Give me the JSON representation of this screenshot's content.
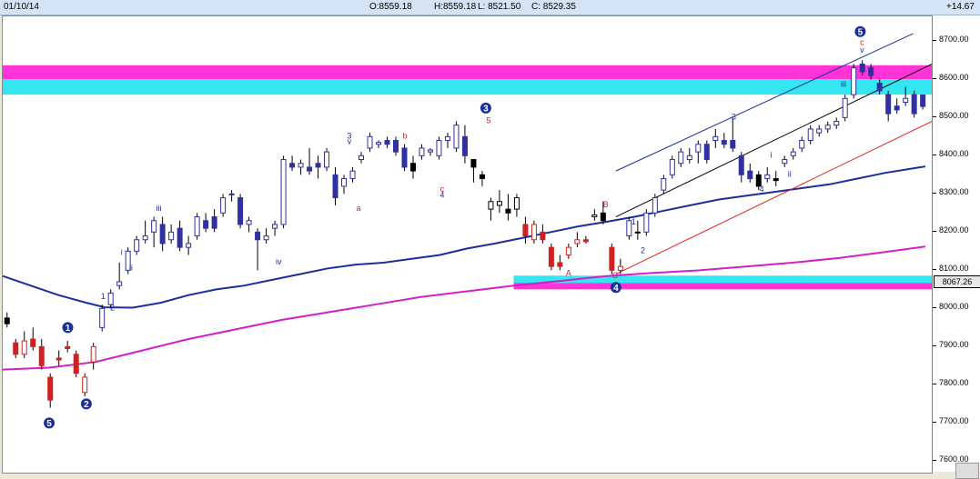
{
  "header": {
    "date": "01/10/14",
    "open": "O:8559.18",
    "high": "H:8559.18",
    "low": "L: 8521.50",
    "close": "C: 8529.35",
    "change": "+14.67"
  },
  "axis": {
    "labels": [
      "8700.00",
      "8600.00",
      "8500.00",
      "8400.00",
      "8300.00",
      "8200.00",
      "8100.00",
      "8000.00",
      "7900.00",
      "7800.00",
      "7700.00",
      "7600.00"
    ],
    "price_box": "8067.26"
  },
  "colors": {
    "up": "#3030a0",
    "down": "#000000",
    "up_red": "#d02020",
    "ma_short": "#1a2f9a",
    "ma_long": "#d020c8",
    "zone_cyan": "#33e6f0",
    "zone_magenta": "#ff33d6",
    "trend_red": "#e02020"
  },
  "chart_data": {
    "type": "candlestick",
    "ylim": [
      7570,
      8765
    ],
    "y_ticks": [
      8700,
      8600,
      8500,
      8400,
      8300,
      8200,
      8100,
      8000,
      7900,
      7800,
      7700,
      7600
    ],
    "zones": [
      {
        "color": "magenta",
        "top": 8637,
        "bottom": 8600,
        "x_from": 0,
        "x_to": 1
      },
      {
        "color": "cyan",
        "top": 8600,
        "bottom": 8560,
        "x_from": 0,
        "x_to": 1
      },
      {
        "color": "cyan",
        "top": 8086,
        "bottom": 8067,
        "x_from": 0.55,
        "x_to": 1
      },
      {
        "color": "magenta",
        "top": 8067,
        "bottom": 8050,
        "x_from": 0.55,
        "x_to": 1
      }
    ],
    "candles": [
      {
        "o": 7975,
        "h": 7990,
        "l": 7950,
        "c": 7960,
        "col": "down"
      },
      {
        "o": 7910,
        "h": 7920,
        "l": 7870,
        "c": 7880,
        "col": "down_red"
      },
      {
        "o": 7880,
        "h": 7940,
        "l": 7870,
        "c": 7915,
        "col": "up_red"
      },
      {
        "o": 7920,
        "h": 7950,
        "l": 7890,
        "c": 7900,
        "col": "down_red"
      },
      {
        "o": 7900,
        "h": 7920,
        "l": 7840,
        "c": 7850,
        "col": "down_red"
      },
      {
        "o": 7820,
        "h": 7830,
        "l": 7740,
        "c": 7760,
        "col": "down_red"
      },
      {
        "o": 7870,
        "h": 7890,
        "l": 7850,
        "c": 7865,
        "col": "up_red"
      },
      {
        "o": 7900,
        "h": 7915,
        "l": 7885,
        "c": 7895,
        "col": "down_red"
      },
      {
        "o": 7880,
        "h": 7890,
        "l": 7820,
        "c": 7830,
        "col": "down_red"
      },
      {
        "o": 7780,
        "h": 7830,
        "l": 7770,
        "c": 7820,
        "col": "up_red"
      },
      {
        "o": 7860,
        "h": 7910,
        "l": 7840,
        "c": 7900,
        "col": "up_red"
      },
      {
        "o": 7950,
        "h": 8010,
        "l": 7940,
        "c": 8000,
        "col": "up"
      },
      {
        "o": 8010,
        "h": 8050,
        "l": 8000,
        "c": 8040,
        "col": "up"
      },
      {
        "o": 8060,
        "h": 8120,
        "l": 8050,
        "c": 8070,
        "col": "up"
      },
      {
        "o": 8100,
        "h": 8160,
        "l": 8090,
        "c": 8150,
        "col": "up"
      },
      {
        "o": 8150,
        "h": 8190,
        "l": 8140,
        "c": 8180,
        "col": "up"
      },
      {
        "o": 8180,
        "h": 8230,
        "l": 8170,
        "c": 8190,
        "col": "up"
      },
      {
        "o": 8200,
        "h": 8240,
        "l": 8160,
        "c": 8230,
        "col": "up"
      },
      {
        "o": 8220,
        "h": 8240,
        "l": 8150,
        "c": 8170,
        "col": "up"
      },
      {
        "o": 8180,
        "h": 8220,
        "l": 8170,
        "c": 8200,
        "col": "up"
      },
      {
        "o": 8210,
        "h": 8230,
        "l": 8150,
        "c": 8160,
        "col": "up"
      },
      {
        "o": 8160,
        "h": 8190,
        "l": 8140,
        "c": 8170,
        "col": "up"
      },
      {
        "o": 8190,
        "h": 8250,
        "l": 8180,
        "c": 8240,
        "col": "up"
      },
      {
        "o": 8230,
        "h": 8250,
        "l": 8200,
        "c": 8210,
        "col": "up"
      },
      {
        "o": 8240,
        "h": 8260,
        "l": 8200,
        "c": 8210,
        "col": "up"
      },
      {
        "o": 8250,
        "h": 8300,
        "l": 8240,
        "c": 8290,
        "col": "up"
      },
      {
        "o": 8300,
        "h": 8310,
        "l": 8280,
        "c": 8300,
        "col": "up"
      },
      {
        "o": 8290,
        "h": 8300,
        "l": 8210,
        "c": 8220,
        "col": "up"
      },
      {
        "o": 8220,
        "h": 8240,
        "l": 8200,
        "c": 8230,
        "col": "up"
      },
      {
        "o": 8200,
        "h": 8210,
        "l": 8100,
        "c": 8180,
        "col": "up"
      },
      {
        "o": 8180,
        "h": 8210,
        "l": 8170,
        "c": 8190,
        "col": "up"
      },
      {
        "o": 8210,
        "h": 8230,
        "l": 8190,
        "c": 8220,
        "col": "up"
      },
      {
        "o": 8220,
        "h": 8400,
        "l": 8210,
        "c": 8390,
        "col": "up"
      },
      {
        "o": 8380,
        "h": 8400,
        "l": 8360,
        "c": 8370,
        "col": "up"
      },
      {
        "o": 8370,
        "h": 8390,
        "l": 8350,
        "c": 8380,
        "col": "up"
      },
      {
        "o": 8370,
        "h": 8420,
        "l": 8350,
        "c": 8360,
        "col": "up"
      },
      {
        "o": 8380,
        "h": 8400,
        "l": 8340,
        "c": 8370,
        "col": "up"
      },
      {
        "o": 8370,
        "h": 8420,
        "l": 8360,
        "c": 8410,
        "col": "up"
      },
      {
        "o": 8350,
        "h": 8370,
        "l": 8270,
        "c": 8290,
        "col": "up"
      },
      {
        "o": 8320,
        "h": 8350,
        "l": 8300,
        "c": 8340,
        "col": "up"
      },
      {
        "o": 8340,
        "h": 8370,
        "l": 8330,
        "c": 8360,
        "col": "up"
      },
      {
        "o": 8390,
        "h": 8410,
        "l": 8380,
        "c": 8400,
        "col": "up"
      },
      {
        "o": 8420,
        "h": 8460,
        "l": 8410,
        "c": 8450,
        "col": "up"
      },
      {
        "o": 8430,
        "h": 8440,
        "l": 8420,
        "c": 8435,
        "col": "up"
      },
      {
        "o": 8440,
        "h": 8450,
        "l": 8420,
        "c": 8430,
        "col": "up"
      },
      {
        "o": 8440,
        "h": 8450,
        "l": 8400,
        "c": 8410,
        "col": "up"
      },
      {
        "o": 8420,
        "h": 8430,
        "l": 8360,
        "c": 8370,
        "col": "up"
      },
      {
        "o": 8380,
        "h": 8400,
        "l": 8340,
        "c": 8360,
        "col": "down"
      },
      {
        "o": 8400,
        "h": 8430,
        "l": 8390,
        "c": 8420,
        "col": "up"
      },
      {
        "o": 8410,
        "h": 8420,
        "l": 8400,
        "c": 8415,
        "col": "up"
      },
      {
        "o": 8400,
        "h": 8450,
        "l": 8390,
        "c": 8440,
        "col": "up"
      },
      {
        "o": 8440,
        "h": 8460,
        "l": 8420,
        "c": 8450,
        "col": "up"
      },
      {
        "o": 8420,
        "h": 8490,
        "l": 8410,
        "c": 8480,
        "col": "up"
      },
      {
        "o": 8450,
        "h": 8480,
        "l": 8380,
        "c": 8400,
        "col": "up"
      },
      {
        "o": 8390,
        "h": 8390,
        "l": 8330,
        "c": 8370,
        "col": "down"
      },
      {
        "o": 8350,
        "h": 8360,
        "l": 8320,
        "c": 8340,
        "col": "down"
      },
      {
        "o": 8260,
        "h": 8290,
        "l": 8230,
        "c": 8280,
        "col": "down"
      },
      {
        "o": 8270,
        "h": 8310,
        "l": 8250,
        "c": 8280,
        "col": "down"
      },
      {
        "o": 8260,
        "h": 8300,
        "l": 8230,
        "c": 8250,
        "col": "down"
      },
      {
        "o": 8260,
        "h": 8300,
        "l": 8240,
        "c": 8290,
        "col": "down"
      },
      {
        "o": 8220,
        "h": 8240,
        "l": 8170,
        "c": 8190,
        "col": "down_red"
      },
      {
        "o": 8180,
        "h": 8230,
        "l": 8170,
        "c": 8220,
        "col": "down_red"
      },
      {
        "o": 8200,
        "h": 8220,
        "l": 8170,
        "c": 8180,
        "col": "down_red"
      },
      {
        "o": 8160,
        "h": 8170,
        "l": 8100,
        "c": 8110,
        "col": "down_red"
      },
      {
        "o": 8120,
        "h": 8140,
        "l": 8100,
        "c": 8110,
        "col": "up_red"
      },
      {
        "o": 8140,
        "h": 8170,
        "l": 8130,
        "c": 8160,
        "col": "up_red"
      },
      {
        "o": 8170,
        "h": 8200,
        "l": 8160,
        "c": 8180,
        "col": "up_red"
      },
      {
        "o": 8180,
        "h": 8190,
        "l": 8170,
        "c": 8175,
        "col": "down_red"
      },
      {
        "o": 8240,
        "h": 8260,
        "l": 8230,
        "c": 8245,
        "col": "down"
      },
      {
        "o": 8250,
        "h": 8280,
        "l": 8220,
        "c": 8230,
        "col": "down"
      },
      {
        "o": 8160,
        "h": 8170,
        "l": 8090,
        "c": 8100,
        "col": "down_red"
      },
      {
        "o": 8100,
        "h": 8130,
        "l": 8090,
        "c": 8110,
        "col": "up_red"
      },
      {
        "o": 8190,
        "h": 8240,
        "l": 8180,
        "c": 8230,
        "col": "up"
      },
      {
        "o": 8200,
        "h": 8230,
        "l": 8180,
        "c": 8200,
        "col": "down"
      },
      {
        "o": 8200,
        "h": 8260,
        "l": 8190,
        "c": 8250,
        "col": "up"
      },
      {
        "o": 8250,
        "h": 8300,
        "l": 8240,
        "c": 8290,
        "col": "up"
      },
      {
        "o": 8310,
        "h": 8350,
        "l": 8300,
        "c": 8340,
        "col": "up"
      },
      {
        "o": 8350,
        "h": 8400,
        "l": 8340,
        "c": 8390,
        "col": "up"
      },
      {
        "o": 8380,
        "h": 8420,
        "l": 8370,
        "c": 8410,
        "col": "up"
      },
      {
        "o": 8390,
        "h": 8420,
        "l": 8380,
        "c": 8400,
        "col": "up"
      },
      {
        "o": 8410,
        "h": 8440,
        "l": 8380,
        "c": 8430,
        "col": "up"
      },
      {
        "o": 8430,
        "h": 8440,
        "l": 8380,
        "c": 8390,
        "col": "up"
      },
      {
        "o": 8440,
        "h": 8470,
        "l": 8420,
        "c": 8450,
        "col": "up"
      },
      {
        "o": 8440,
        "h": 8460,
        "l": 8420,
        "c": 8430,
        "col": "up"
      },
      {
        "o": 8440,
        "h": 8500,
        "l": 8410,
        "c": 8420,
        "col": "up"
      },
      {
        "o": 8400,
        "h": 8410,
        "l": 8330,
        "c": 8350,
        "col": "up"
      },
      {
        "o": 8360,
        "h": 8380,
        "l": 8330,
        "c": 8340,
        "col": "up"
      },
      {
        "o": 8350,
        "h": 8360,
        "l": 8310,
        "c": 8320,
        "col": "down"
      },
      {
        "o": 8340,
        "h": 8370,
        "l": 8330,
        "c": 8350,
        "col": "up"
      },
      {
        "o": 8340,
        "h": 8360,
        "l": 8320,
        "c": 8335,
        "col": "down"
      },
      {
        "o": 8380,
        "h": 8400,
        "l": 8370,
        "c": 8390,
        "col": "up"
      },
      {
        "o": 8400,
        "h": 8420,
        "l": 8390,
        "c": 8410,
        "col": "up"
      },
      {
        "o": 8420,
        "h": 8450,
        "l": 8410,
        "c": 8440,
        "col": "up"
      },
      {
        "o": 8440,
        "h": 8480,
        "l": 8430,
        "c": 8470,
        "col": "up"
      },
      {
        "o": 8460,
        "h": 8480,
        "l": 8450,
        "c": 8470,
        "col": "up"
      },
      {
        "o": 8470,
        "h": 8490,
        "l": 8460,
        "c": 8480,
        "col": "up"
      },
      {
        "o": 8480,
        "h": 8500,
        "l": 8470,
        "c": 8490,
        "col": "up"
      },
      {
        "o": 8500,
        "h": 8560,
        "l": 8490,
        "c": 8550,
        "col": "up"
      },
      {
        "o": 8560,
        "h": 8640,
        "l": 8550,
        "c": 8630,
        "col": "up"
      },
      {
        "o": 8640,
        "h": 8650,
        "l": 8610,
        "c": 8620,
        "col": "up"
      },
      {
        "o": 8630,
        "h": 8640,
        "l": 8600,
        "c": 8610,
        "col": "up"
      },
      {
        "o": 8590,
        "h": 8600,
        "l": 8560,
        "c": 8570,
        "col": "up"
      },
      {
        "o": 8560,
        "h": 8570,
        "l": 8490,
        "c": 8510,
        "col": "up"
      },
      {
        "o": 8530,
        "h": 8550,
        "l": 8510,
        "c": 8520,
        "col": "up"
      },
      {
        "o": 8540,
        "h": 8580,
        "l": 8530,
        "c": 8550,
        "col": "up"
      },
      {
        "o": 8560,
        "h": 8570,
        "l": 8500,
        "c": 8510,
        "col": "up"
      },
      {
        "o": 8559,
        "h": 8559,
        "l": 8521,
        "c": 8529,
        "col": "up"
      }
    ],
    "ma_short": [
      [
        0,
        8085
      ],
      [
        0.03,
        8060
      ],
      [
        0.06,
        8035
      ],
      [
        0.09,
        8015
      ],
      [
        0.11,
        8003
      ],
      [
        0.14,
        8002
      ],
      [
        0.17,
        8015
      ],
      [
        0.2,
        8035
      ],
      [
        0.23,
        8050
      ],
      [
        0.26,
        8060
      ],
      [
        0.29,
        8075
      ],
      [
        0.32,
        8090
      ],
      [
        0.35,
        8105
      ],
      [
        0.38,
        8115
      ],
      [
        0.41,
        8120
      ],
      [
        0.44,
        8130
      ],
      [
        0.47,
        8140
      ],
      [
        0.5,
        8157
      ],
      [
        0.53,
        8170
      ],
      [
        0.56,
        8185
      ],
      [
        0.59,
        8200
      ],
      [
        0.62,
        8215
      ],
      [
        0.65,
        8227
      ],
      [
        0.68,
        8240
      ],
      [
        0.71,
        8255
      ],
      [
        0.74,
        8270
      ],
      [
        0.77,
        8285
      ],
      [
        0.8,
        8295
      ],
      [
        0.83,
        8305
      ],
      [
        0.86,
        8315
      ],
      [
        0.89,
        8325
      ],
      [
        0.92,
        8340
      ],
      [
        0.95,
        8355
      ],
      [
        0.97,
        8363
      ],
      [
        0.993,
        8372
      ]
    ],
    "ma_long": [
      [
        0,
        7840
      ],
      [
        0.05,
        7845
      ],
      [
        0.1,
        7860
      ],
      [
        0.15,
        7890
      ],
      [
        0.2,
        7920
      ],
      [
        0.25,
        7945
      ],
      [
        0.3,
        7970
      ],
      [
        0.35,
        7990
      ],
      [
        0.4,
        8010
      ],
      [
        0.45,
        8030
      ],
      [
        0.5,
        8045
      ],
      [
        0.55,
        8060
      ],
      [
        0.6,
        8072
      ],
      [
        0.65,
        8085
      ],
      [
        0.7,
        8093
      ],
      [
        0.75,
        8100
      ],
      [
        0.8,
        8110
      ],
      [
        0.85,
        8120
      ],
      [
        0.9,
        8132
      ],
      [
        0.95,
        8148
      ],
      [
        0.993,
        8162
      ]
    ],
    "trendlines": [
      {
        "color": "blue",
        "from": [
          0.66,
          8360
        ],
        "to": [
          0.98,
          8720
        ]
      },
      {
        "color": "black",
        "from": [
          0.66,
          8240
        ],
        "to": [
          1.0,
          8640
        ]
      },
      {
        "color": "red",
        "from": [
          0.66,
          8090
        ],
        "to": [
          1.0,
          8490
        ]
      }
    ],
    "markers": [
      {
        "label": "5",
        "x": 0.05,
        "y": 7700,
        "style": "circle"
      },
      {
        "label": "1",
        "x": 0.07,
        "y": 7950,
        "style": "circle"
      },
      {
        "label": "2",
        "x": 0.09,
        "y": 7750,
        "style": "circle"
      },
      {
        "label": "3",
        "x": 0.52,
        "y": 8525,
        "style": "circle"
      },
      {
        "label": "4",
        "x": 0.66,
        "y": 8055,
        "style": "circle"
      },
      {
        "label": "5",
        "x": 0.923,
        "y": 8725,
        "style": "circle"
      }
    ],
    "annotations": [
      {
        "label": "1",
        "x": 0.108,
        "y": 8025,
        "color": "blue"
      },
      {
        "label": "2",
        "x": 0.118,
        "y": 7995,
        "color": "blue"
      },
      {
        "label": "i",
        "x": 0.128,
        "y": 8140,
        "color": "blue"
      },
      {
        "label": "ii",
        "x": 0.138,
        "y": 8100,
        "color": "blue"
      },
      {
        "label": "iii",
        "x": 0.168,
        "y": 8255,
        "color": "blue"
      },
      {
        "label": "3",
        "x": 0.373,
        "y": 8445,
        "color": "blue"
      },
      {
        "label": "v",
        "x": 0.373,
        "y": 8430,
        "color": "blue"
      },
      {
        "label": "iv",
        "x": 0.297,
        "y": 8115,
        "color": "blue"
      },
      {
        "label": "a",
        "x": 0.383,
        "y": 8255,
        "color": "red"
      },
      {
        "label": "b",
        "x": 0.433,
        "y": 8445,
        "color": "red"
      },
      {
        "label": "c",
        "x": 0.473,
        "y": 8305,
        "color": "red"
      },
      {
        "label": "4",
        "x": 0.473,
        "y": 8290,
        "color": "blue"
      },
      {
        "label": "5",
        "x": 0.523,
        "y": 8485,
        "color": "red"
      },
      {
        "label": "A",
        "x": 0.609,
        "y": 8085,
        "color": "red"
      },
      {
        "label": "B",
        "x": 0.649,
        "y": 8265,
        "color": "red"
      },
      {
        "label": "C",
        "x": 0.659,
        "y": 8080,
        "color": "red"
      },
      {
        "label": "1",
        "x": 0.679,
        "y": 8220,
        "color": "blue"
      },
      {
        "label": "2",
        "x": 0.689,
        "y": 8145,
        "color": "blue"
      },
      {
        "label": "3",
        "x": 0.787,
        "y": 8495,
        "color": "blue"
      },
      {
        "label": "4",
        "x": 0.817,
        "y": 8305,
        "color": "blue"
      },
      {
        "label": "i",
        "x": 0.827,
        "y": 8395,
        "color": "blue"
      },
      {
        "label": "ii",
        "x": 0.847,
        "y": 8345,
        "color": "blue"
      },
      {
        "label": "iii",
        "x": 0.905,
        "y": 8580,
        "color": "blue"
      },
      {
        "label": "c",
        "x": 0.925,
        "y": 8690,
        "color": "red"
      },
      {
        "label": "v",
        "x": 0.925,
        "y": 8670,
        "color": "blue"
      }
    ]
  }
}
